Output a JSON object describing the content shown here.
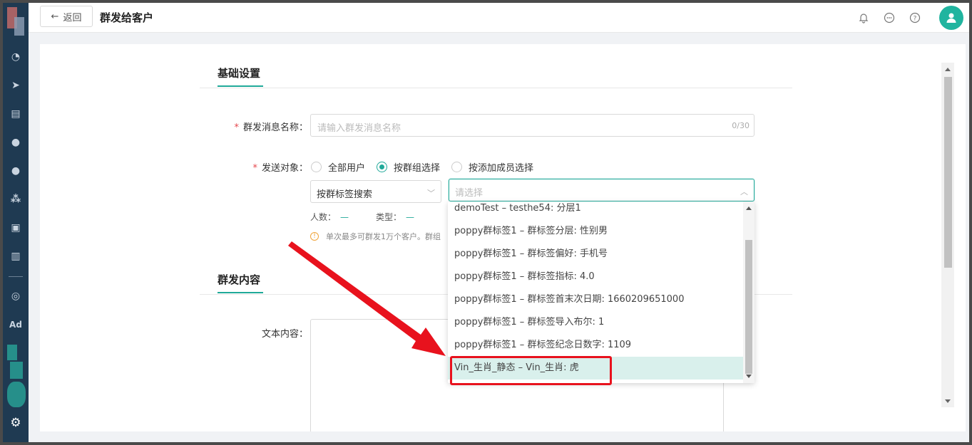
{
  "header": {
    "back_label": "返回",
    "title": "群发给客户"
  },
  "sidebar": {
    "items": [
      {
        "icon": "dashboard-icon",
        "glyph": "◔"
      },
      {
        "icon": "send-icon",
        "glyph": "➤"
      },
      {
        "icon": "layout-icon",
        "glyph": "▤"
      },
      {
        "icon": "user-icon",
        "glyph": "●"
      },
      {
        "icon": "users-icon",
        "glyph": "●"
      },
      {
        "icon": "group-icon",
        "glyph": "⁂"
      },
      {
        "icon": "contact-card-icon",
        "glyph": "▣"
      },
      {
        "icon": "bar-chart-icon",
        "glyph": "▥"
      },
      {
        "icon": "wechat-icon",
        "glyph": "◎"
      },
      {
        "icon": "ad-icon",
        "glyph": "Ad"
      }
    ]
  },
  "form": {
    "basic_section_title": "基础设置",
    "name_label": "群发消息名称：",
    "name_placeholder": "请输入群发消息名称",
    "name_count": "0/30",
    "target_label": "发送对象：",
    "radio_all": "全部用户",
    "radio_group": "按群组选择",
    "radio_member": "按添加成员选择",
    "tag_search_select": "按群标签搜索",
    "tag_select_placeholder": "请选择",
    "people_label": "人数：",
    "people_value": "—",
    "type_label": "类型：",
    "type_value": "—",
    "tip_text": "单次最多可群发1万个客户。群组",
    "content_section_title": "群发内容",
    "text_content_label": "文本内容："
  },
  "dropdown": {
    "options": [
      "demoTest – testhe54: 分层1",
      "poppy群标签1 – 群标签分层: 性别男",
      "poppy群标签1 – 群标签偏好: 手机号",
      "poppy群标签1 – 群标签指标: 4.0",
      "poppy群标签1 – 群标签首末次日期: 1660209651000",
      "poppy群标签1 – 群标签导入布尔: 1",
      "poppy群标签1 – 群标签纪念日数字: 1109",
      "Vin_生肖_静态 – Vin_生肖: 虎"
    ],
    "highlighted_index": 7
  },
  "colors": {
    "accent": "#20a999",
    "sidebar": "#1f3a52",
    "annotation": "#e8121d"
  }
}
